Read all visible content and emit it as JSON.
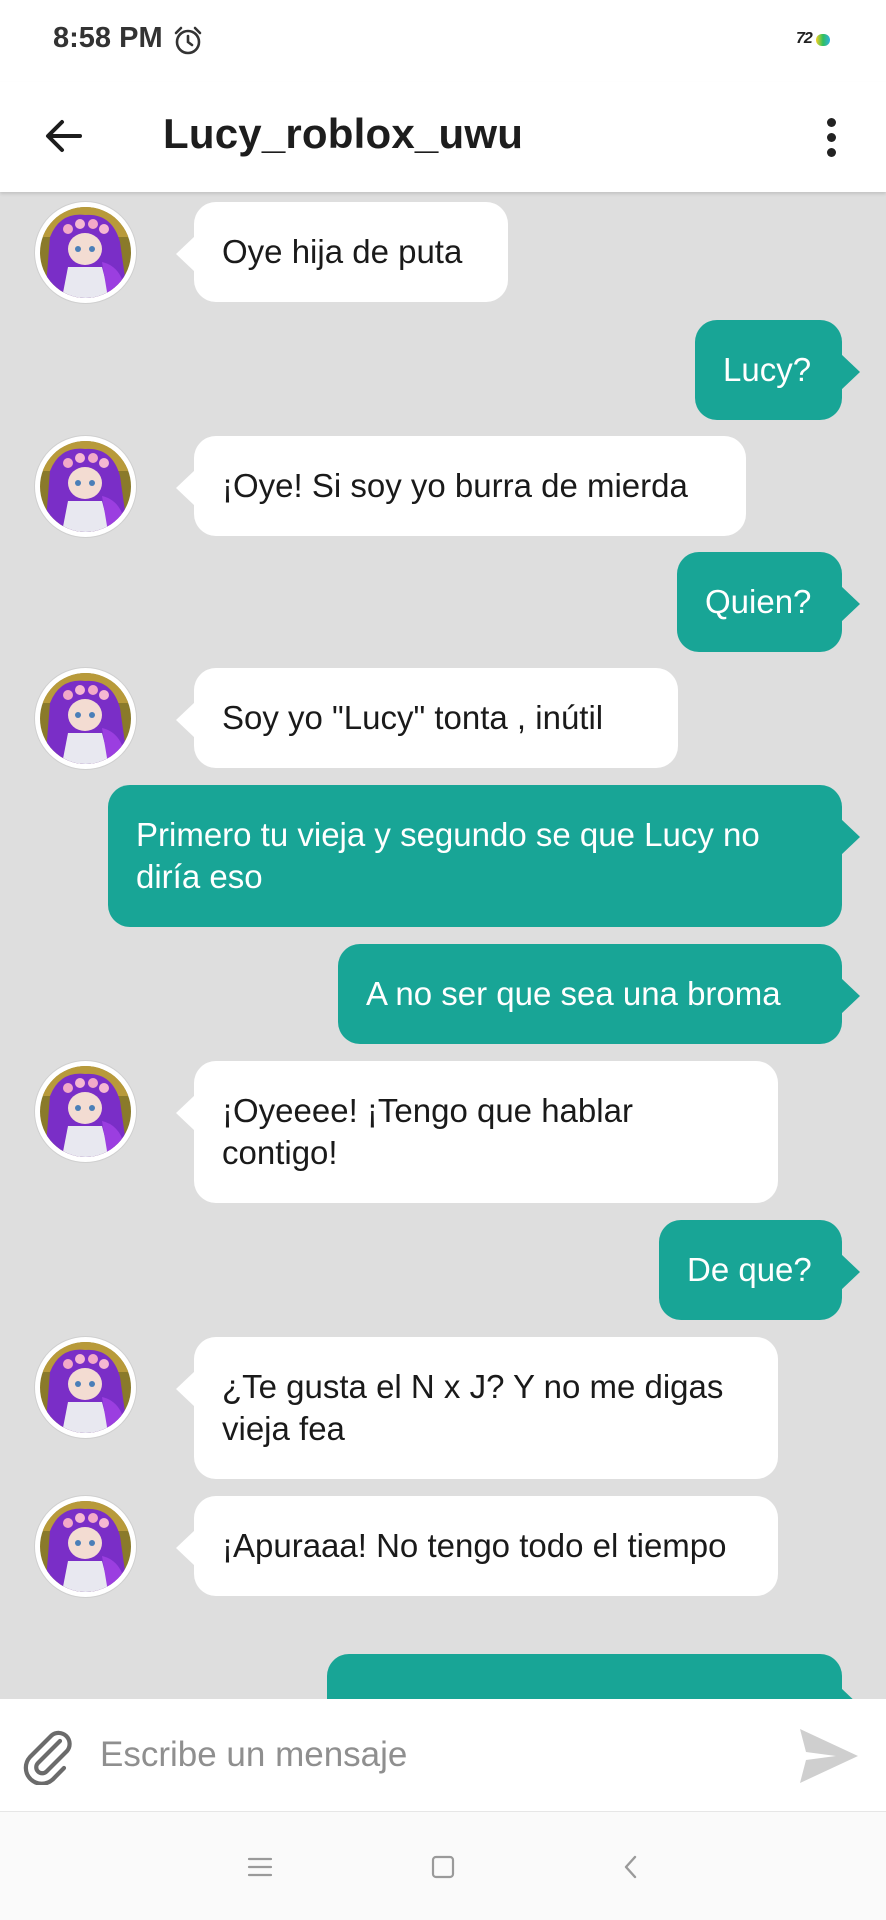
{
  "status_bar": {
    "time": "8:58 PM",
    "alarm_icon": "alarm-clock-icon",
    "battery_label": "72"
  },
  "header": {
    "title": "Lucy_roblox_uwu",
    "back_icon": "arrow-left-icon",
    "menu_icon": "more-vertical-icon"
  },
  "messages": [
    {
      "side": "in",
      "text": "Oye hija de puta"
    },
    {
      "side": "out",
      "text": "Lucy?"
    },
    {
      "side": "in",
      "text": "¡Oye! Si soy yo burra de mierda"
    },
    {
      "side": "out",
      "text": "Quien?"
    },
    {
      "side": "in",
      "text": "Soy yo \"Lucy\" tonta , inútil"
    },
    {
      "side": "out",
      "text": "Primero tu vieja y segundo se que Lucy no diría eso"
    },
    {
      "side": "out",
      "text": "A no ser que sea una broma"
    },
    {
      "side": "in",
      "text": "¡Oyeeee! ¡Tengo que hablar contigo!"
    },
    {
      "side": "out",
      "text": "De que?"
    },
    {
      "side": "in",
      "text": "¿Te gusta el N x J? Y no me digas vieja fea"
    },
    {
      "side": "in",
      "text": "¡Apuraaa! No tengo todo el tiempo"
    }
  ],
  "composer": {
    "placeholder": "Escribe un mensaje",
    "attach_icon": "paperclip-icon",
    "send_icon": "send-icon"
  },
  "nav": {
    "menu_icon": "nav-menu-icon",
    "home_icon": "nav-home-icon",
    "back_icon": "nav-back-icon"
  },
  "colors": {
    "outgoing_bubble": "#18a596",
    "incoming_bubble": "#ffffff",
    "chat_background": "#dedede",
    "header_background": "#ffffff"
  }
}
